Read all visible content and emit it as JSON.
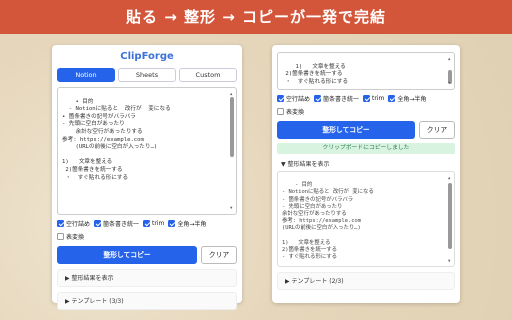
{
  "banner": {
    "title": "貼る → 整形 → コピーが一発で完結"
  },
  "left": {
    "app_title": "ClipForge",
    "tabs": [
      {
        "label": "Notion",
        "active": true
      },
      {
        "label": "Sheets",
        "active": false
      },
      {
        "label": "Custom",
        "active": false
      }
    ],
    "input_text": "• 目的\n  - Notionに貼ると  改行が  変になる\n• 箇条書きの記号がバラバラ\n- 先頭に空白があったり\n    余計な空行があったりする\n参考: https://example.com\n    (URLの前後に空白が入ったり…)\n\n1)   文章を整える\n 2)箇条書きを統一する\n ・  すぐ貼れる形にする",
    "options": [
      {
        "label": "空行詰め",
        "checked": true
      },
      {
        "label": "箇条書き統一",
        "checked": true
      },
      {
        "label": "trim",
        "checked": true
      },
      {
        "label": "全角→半角",
        "checked": true
      },
      {
        "label": "表変換",
        "checked": false
      }
    ],
    "primary_button": "整形してコピー",
    "secondary_button": "クリア",
    "section_result": "▶ 整形結果を表示",
    "section_templates": "▶ テンプレート (3/3)"
  },
  "right": {
    "input_text": "1)   文章を整える\n 2)箇条書きを統一する\n ・  すぐ貼れる形にする",
    "options": [
      {
        "label": "空行詰め",
        "checked": true
      },
      {
        "label": "箇条書き統一",
        "checked": true
      },
      {
        "label": "trim",
        "checked": true
      },
      {
        "label": "全角→半角",
        "checked": true
      },
      {
        "label": "表変換",
        "checked": false
      }
    ],
    "primary_button": "整形してコピー",
    "secondary_button": "クリア",
    "toast": "クリップボードにコピーしました",
    "result_header": "▼ 整形結果を表示",
    "result_text": "- 目的\n- Notionに貼ると 改行が 変になる\n- 箇条書きの記号がバラバラ\n- 先頭に空白があったり\n余計な空行があったりする\n参考: https://example.com\n(URLの前後に空白が入ったり…)\n\n1)   文章を整える\n2)箇条書きを統一する\n- すぐ貼れる形にする",
    "section_templates": "▶ テンプレート (2/3)"
  }
}
